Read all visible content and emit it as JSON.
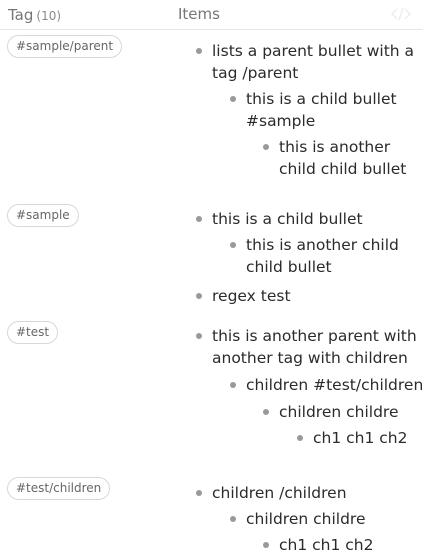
{
  "header": {
    "tag_label": "Tag",
    "tag_count": "(10)",
    "items_label": "Items",
    "icon": "code-icon"
  },
  "groups": [
    {
      "tag": "#sample/parent",
      "bullets": [
        {
          "line1": "lists a parent bullet with a",
          "line2": "tag /parent"
        },
        {
          "line1": "this is a child bullet",
          "line2": "#sample"
        },
        {
          "line1": "this is another",
          "line2": "child child bullet"
        }
      ]
    },
    {
      "tag": "#sample",
      "bullets": [
        {
          "line1": "this is a child bullet"
        },
        {
          "line1": "this is another child",
          "line2": "child bullet"
        },
        {
          "line1": "regex test"
        }
      ]
    },
    {
      "tag": "#test",
      "bullets": [
        {
          "line1": "this is another parent with",
          "line2": "another tag with children"
        },
        {
          "line1": "children #test/children"
        },
        {
          "line1": "children childre"
        },
        {
          "line1": "ch1 ch1 ch2"
        }
      ]
    },
    {
      "tag": "#test/children",
      "bullets": [
        {
          "line1": "children /children"
        },
        {
          "line1": "children childre"
        },
        {
          "line1": "ch1 ch1 ch2"
        }
      ]
    }
  ],
  "colors": {
    "bullet_dot": "#999999",
    "pill_border": "#d8d8d8",
    "header_text": "#777777"
  }
}
